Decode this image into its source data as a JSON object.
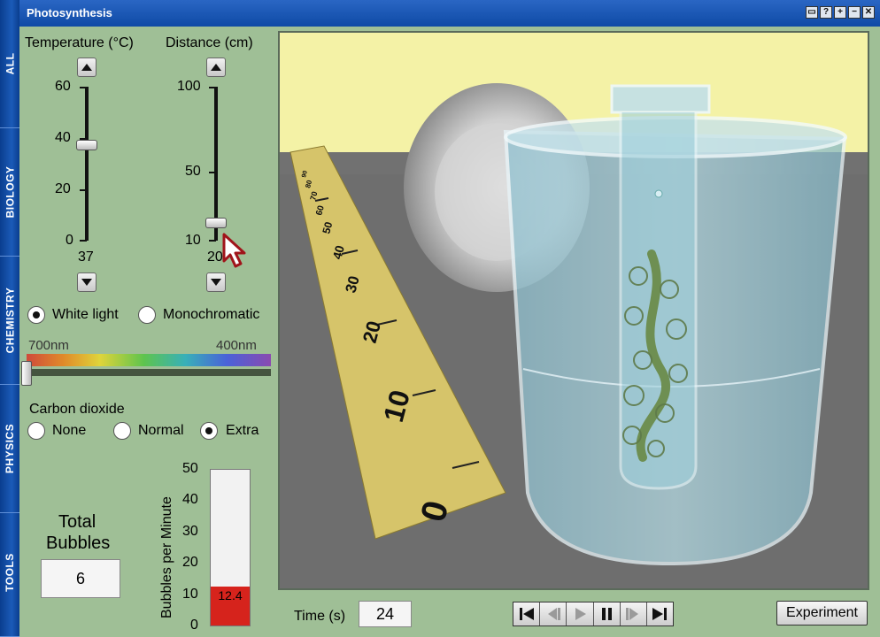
{
  "window": {
    "title": "Photosynthesis"
  },
  "side_tabs": [
    "ALL",
    "BIOLOGY",
    "CHEMISTRY",
    "PHYSICS",
    "TOOLS"
  ],
  "temperature": {
    "label": "Temperature (°C)",
    "ticks": [
      "60",
      "40",
      "20",
      "0"
    ],
    "value": "37"
  },
  "distance": {
    "label": "Distance (cm)",
    "ticks": [
      "100",
      "50",
      "10"
    ],
    "value": "20"
  },
  "light": {
    "options": [
      "White light",
      "Monochromatic"
    ],
    "selected": "White light",
    "spectrum_left": "700nm",
    "spectrum_right": "400nm"
  },
  "co2": {
    "label": "Carbon dioxide",
    "options": [
      "None",
      "Normal",
      "Extra"
    ],
    "selected": "Extra"
  },
  "total_bubbles": {
    "label_line1": "Total",
    "label_line2": "Bubbles",
    "value": "6"
  },
  "bubbles_gauge": {
    "axis_label": "Bubbles per Minute",
    "ticks": [
      "50",
      "40",
      "30",
      "20",
      "10",
      "0"
    ],
    "value": "12.4",
    "fraction": 0.248,
    "fill_color": "#d6231c"
  },
  "ruler_labels": [
    "0",
    "10",
    "20",
    "30",
    "40",
    "50",
    "60",
    "70",
    "80",
    "90"
  ],
  "time": {
    "label": "Time (s)",
    "value": "24"
  },
  "transport": [
    "skip-to-start-icon",
    "step-back-icon",
    "play-icon",
    "pause-icon",
    "step-forward-icon",
    "skip-to-end-icon"
  ],
  "experiment_button": "Experiment"
}
